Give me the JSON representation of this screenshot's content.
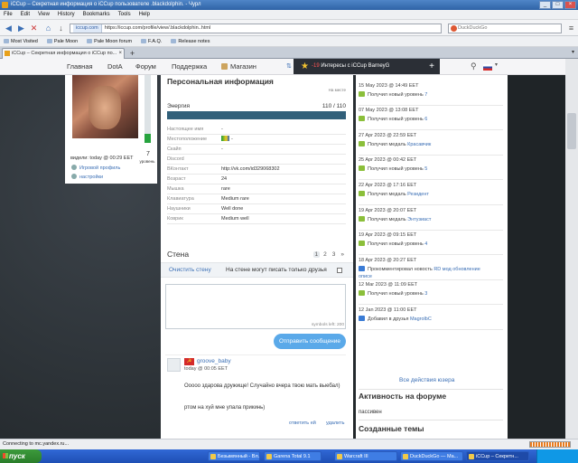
{
  "window": {
    "title": "iCCup – Секретная информация о iCCup пользователе .blackdolphin. - Чурл"
  },
  "menu": [
    "File",
    "Edit",
    "View",
    "History",
    "Bookmarks",
    "Tools",
    "Help"
  ],
  "url": {
    "site": "iccup.com",
    "address": "https://iccup.com/profile/view/.blackdolphin..html"
  },
  "search": {
    "placeholder": "DuckDuckGo"
  },
  "bookmarks": [
    "Most Visited",
    "Pale Moon",
    "Pale Moon forum",
    "F.A.Q.",
    "Release notes"
  ],
  "tab": {
    "title": "iCCup – Секретная информация о iCCup по..."
  },
  "sitenav": {
    "items": [
      "Главная",
      "DotA",
      "Форум",
      "Поддержка",
      "Магазин"
    ],
    "banner_prefix": "-19",
    "banner_text": "Интересы с iCCup BarneyG"
  },
  "sidebar": {
    "level": "7",
    "level_label": "уровень",
    "seen": "видели: today @ 00:29 EET",
    "game_profile": "Игровой профиль",
    "settings": "настройки",
    "level_fraction": 0.13
  },
  "profile": {
    "title": "Персональная информация",
    "tag": "На месте",
    "energy_label": "Энергия",
    "energy_value": "110 / 110",
    "energy_fraction": 1.0,
    "rows": [
      {
        "k": "Настоящее имя",
        "v": "-"
      },
      {
        "k": "Местоположение",
        "v": "-"
      },
      {
        "k": "Скайп",
        "v": "-"
      },
      {
        "k": "Discord",
        "v": ""
      },
      {
        "k": "ВКонтакт",
        "v": "http://vk.com/id329068302"
      },
      {
        "k": "Возраст",
        "v": "24"
      },
      {
        "k": "Мышка",
        "v": "rare"
      },
      {
        "k": "Клавиатура",
        "v": "Medium rare"
      },
      {
        "k": "Наушники",
        "v": "Well done"
      },
      {
        "k": "Коврик",
        "v": "Medium well"
      }
    ]
  },
  "wall": {
    "title": "Стена",
    "pages": [
      "1",
      "2",
      "3",
      "»"
    ],
    "clear": "Очистить стену",
    "friends_only": "На стене могут писать только друзья",
    "symbols": "symbols left: 200",
    "send": "Отправить сообщение",
    "post": {
      "author": "groove_baby",
      "time": "today @ 00:05 EET",
      "text1": "Ооооо здарова дружище! Случайно вчера твою мать выебал)",
      "text2": "ртом на хуй мне упала прикинь)",
      "reply": "ответить ей",
      "delete": "удалить"
    }
  },
  "feed": [
    {
      "date": "15 May 2023 @ 14:49 EET",
      "text": "Получил новый уровень",
      "hl": "7",
      "icon_color": "#8bbf3a"
    },
    {
      "date": "07 May 2023 @ 13:08 EET",
      "text": "Получил новый уровень",
      "hl": "6",
      "icon_color": "#8bbf3a"
    },
    {
      "date": "27 Apr 2023 @ 22:59 EET",
      "text": "Получил медаль",
      "hl": "Красавчик",
      "icon_color": "#8bbf3a"
    },
    {
      "date": "25 Apr 2023 @ 00:42 EET",
      "text": "Получил новый уровень",
      "hl": "5",
      "icon_color": "#8bbf3a"
    },
    {
      "date": "22 Apr 2023 @ 17:16 EET",
      "text": "Получил медаль",
      "hl": "Резидент",
      "icon_color": "#8bbf3a"
    },
    {
      "date": "19 Apr 2023 @ 20:07 EET",
      "text": "Получил медаль",
      "hl": "Энтузиаст",
      "icon_color": "#8bbf3a"
    },
    {
      "date": "19 Apr 2023 @ 09:15 EET",
      "text": "Получил новый уровень",
      "hl": "4",
      "icon_color": "#8bbf3a"
    },
    {
      "date": "18 Apr 2023 @ 20:27 EET",
      "text": "Прокомментировал новость",
      "hl": "RD мод обновление",
      "hl2": "описе",
      "icon_color": "#3a7bd5"
    },
    {
      "date": "12 Mar 2023 @ 11:09 EET",
      "text": "Получил новый уровень",
      "hl": "3",
      "icon_color": "#8bbf3a"
    },
    {
      "date": "12 Jan 2023 @ 11:00 EET",
      "text": "Добавил в друзья",
      "hl": "MagrolbC",
      "icon_color": "#3a7bd5"
    }
  ],
  "right": {
    "all_actions": "Все действия юзера",
    "forum_title": "Активность на форуме",
    "forum_val": "пассивен",
    "themes_title": "Созданные темы"
  },
  "status": "Connecting to mc.yandex.ru...",
  "taskbar": {
    "start": "пуск",
    "items": [
      "Безымянный - Вл...",
      "Garena Total 9.1",
      "Warcraft III",
      "DuckDuckGo — Ма...",
      "iCCup – Секретн..."
    ]
  }
}
